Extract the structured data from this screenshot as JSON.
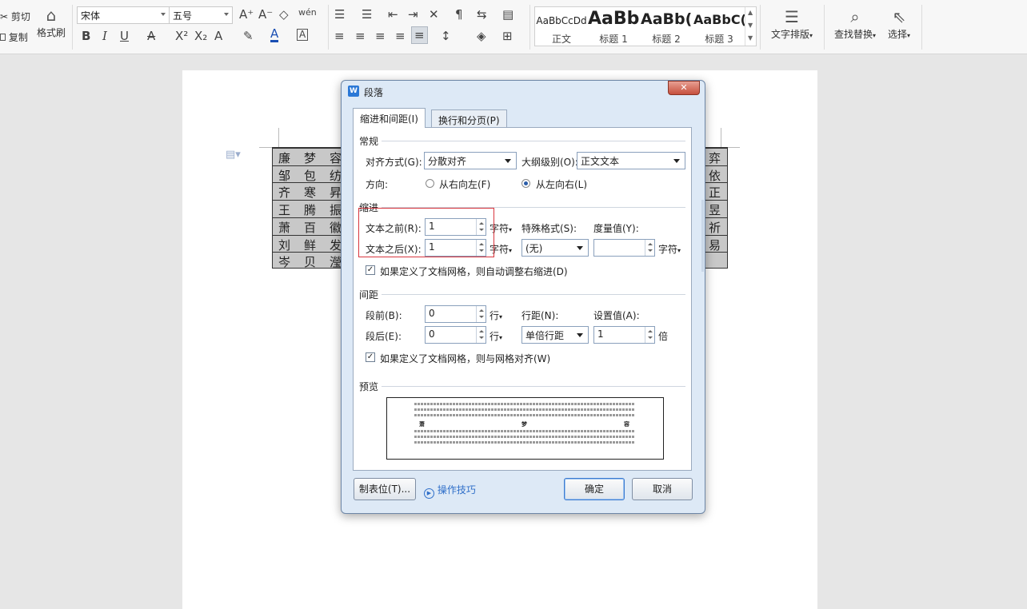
{
  "toolbar": {
    "cut_label": "剪切",
    "copy_label": "复制",
    "format_painter_label": "格式刷",
    "font_name": "宋体",
    "font_size": "五号",
    "pinyin_glyph": "wén",
    "styles": [
      {
        "preview": "AaBbCcDd",
        "label": "正文"
      },
      {
        "preview": "AaBb",
        "label": "标题 1"
      },
      {
        "preview": "AaBb(",
        "label": "标题 2"
      },
      {
        "preview": "AaBbC(",
        "label": "标题 3"
      }
    ],
    "text_layout_label": "文字排版",
    "find_replace_label": "查找替换",
    "select_label": "选择"
  },
  "document": {
    "table_left_col": [
      "廉 梦 容",
      "邹 包 纺",
      "齐 寒 昇",
      "王 腾 振",
      "萧 百 徽",
      "刘 鲜 发",
      "岑 贝 瀅"
    ],
    "table_right_col": [
      "弈",
      "依",
      "正",
      "昱",
      "祈",
      "易",
      ""
    ]
  },
  "dialog": {
    "title": "段落",
    "tabs": [
      "缩进和间距(I)",
      "换行和分页(P)"
    ],
    "general": {
      "section": "常规",
      "align_label": "对齐方式(G):",
      "align_value": "分散对齐",
      "outline_label": "大纲级别(O):",
      "outline_value": "正文文本",
      "direction_label": "方向:",
      "rtl_label": "从右向左(F)",
      "ltr_label": "从左向右(L)"
    },
    "indent": {
      "section": "缩进",
      "before_label": "文本之前(R):",
      "before_value": "1",
      "after_label": "文本之后(X):",
      "after_value": "1",
      "unit": "字符",
      "special_label": "特殊格式(S):",
      "special_value": "(无)",
      "measure_label": "度量值(Y):",
      "measure_value": "",
      "grid_check_label": "如果定义了文档网格，则自动调整右缩进(D)"
    },
    "spacing": {
      "section": "间距",
      "before_label": "段前(B):",
      "before_value": "0",
      "after_label": "段后(E):",
      "after_value": "0",
      "unit": "行",
      "line_label": "行距(N):",
      "line_value": "单倍行距",
      "set_label": "设置值(A):",
      "set_value": "1",
      "set_unit": "倍",
      "grid_check_label": "如果定义了文档网格，则与网格对齐(W)"
    },
    "preview": {
      "section": "预览",
      "chars": [
        "萧",
        "梦",
        "容"
      ]
    },
    "buttons": {
      "tabs_label": "制表位(T)...",
      "tips_label": "操作技巧",
      "ok_label": "确定",
      "cancel_label": "取消"
    }
  },
  "colors": {
    "accent": "#2b5da8",
    "highlight_box": "#d9363e",
    "dialog_bg": "#dde9f6"
  }
}
